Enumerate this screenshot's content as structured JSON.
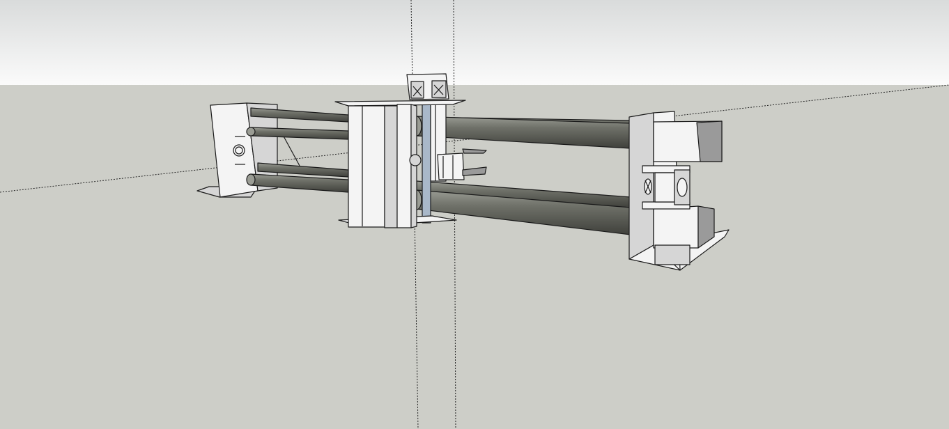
{
  "viewport": {
    "colors": {
      "sky_top": "#d9dbdb",
      "sky_bottom": "#fbfbfb",
      "ground": "#cdcec8",
      "edge": "#1a1a1a",
      "face_light": "#f4f4f4",
      "face_mid": "#d6d6d6",
      "face_dark": "#9a9a9a",
      "rod": "#6f7169",
      "rod_highlight": "#9a9c94",
      "rod_shadow": "#3f403b",
      "leadscrew": "#a9b8c9"
    }
  }
}
